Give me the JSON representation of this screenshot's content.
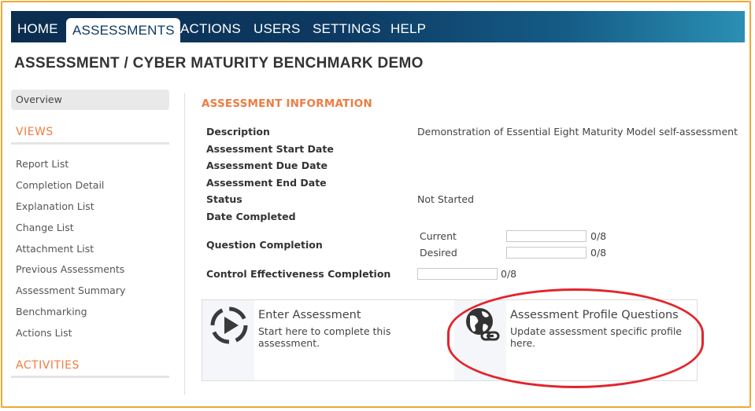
{
  "nav": {
    "items": [
      "HOME",
      "ASSESSMENTS",
      "ACTIONS",
      "USERS",
      "SETTINGS",
      "HELP"
    ],
    "active": "ASSESSMENTS"
  },
  "page_title": "ASSESSMENT / CYBER MATURITY BENCHMARK DEMO",
  "sidebar": {
    "overview": "Overview",
    "views_heading": "VIEWS",
    "views": [
      "Report List",
      "Completion Detail",
      "Explanation List",
      "Change List",
      "Attachment List",
      "Previous Assessments",
      "Assessment Summary",
      "Benchmarking",
      "Actions List"
    ],
    "activities_heading": "ACTIVITIES"
  },
  "info": {
    "title": "ASSESSMENT INFORMATION",
    "description_label": "Description",
    "description_value": "Demonstration of Essential Eight Maturity Model self-assessment",
    "start_label": "Assessment Start Date",
    "due_label": "Assessment Due Date",
    "end_label": "Assessment End Date",
    "status_label": "Status",
    "status_value": "Not Started",
    "completed_label": "Date Completed",
    "question_label": "Question Completion",
    "current_label": "Current",
    "current_value": "0/8",
    "current_fraction": 0,
    "desired_label": "Desired",
    "desired_value": "0/8",
    "desired_fraction": 0,
    "control_label": "Control Effectiveness Completion",
    "control_value": "0/8",
    "control_fraction": 0
  },
  "tiles": [
    {
      "title": "Enter Assessment",
      "desc": "Start here to complete this assessment.",
      "icon": "play-circle-icon"
    },
    {
      "title": "Assessment Profile Questions",
      "desc": "Update assessment specific profile here.",
      "icon": "globe-link-icon"
    }
  ],
  "colors": {
    "accent": "#ef7c42",
    "nav": "#0d3a62",
    "highlight": "#e3242b",
    "frame": "#f0a830"
  }
}
